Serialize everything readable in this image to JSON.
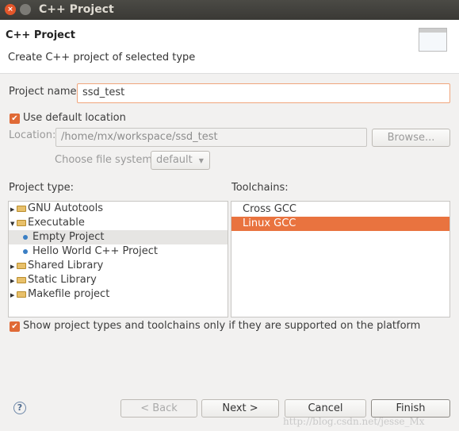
{
  "window": {
    "title": "C++ Project"
  },
  "header": {
    "title": "C++ Project",
    "subtitle": "Create C++ project of selected type"
  },
  "form": {
    "project_name_label": "Project name:",
    "project_name_value": "ssd_test",
    "use_default_label": "Use default location",
    "use_default_checked": true,
    "location_label": "Location:",
    "location_value": "/home/mx/workspace/ssd_test",
    "browse_label": "Browse...",
    "fs_label": "Choose file system:",
    "fs_value": "default"
  },
  "project_type": {
    "label": "Project type:",
    "items": [
      {
        "label": "GNU Autotools",
        "kind": "folder",
        "expanded": false
      },
      {
        "label": "Executable",
        "kind": "folder",
        "expanded": true
      },
      {
        "label": "Empty Project",
        "kind": "leaf",
        "selected": true
      },
      {
        "label": "Hello World C++ Project",
        "kind": "leaf"
      },
      {
        "label": "Shared Library",
        "kind": "folder",
        "expanded": false
      },
      {
        "label": "Static Library",
        "kind": "folder",
        "expanded": false
      },
      {
        "label": "Makefile project",
        "kind": "folder",
        "expanded": false
      }
    ]
  },
  "toolchains": {
    "label": "Toolchains:",
    "items": [
      {
        "label": "Cross GCC"
      },
      {
        "label": "Linux GCC",
        "selected": true
      }
    ]
  },
  "filter": {
    "label": "Show project types and toolchains only if they are supported on the platform",
    "checked": true
  },
  "buttons": {
    "back": "< Back",
    "next": "Next >",
    "cancel": "Cancel",
    "finish": "Finish"
  },
  "watermark": "http://blog.csdn.net/jesse_Mx",
  "colors": {
    "accent": "#e9733f"
  }
}
